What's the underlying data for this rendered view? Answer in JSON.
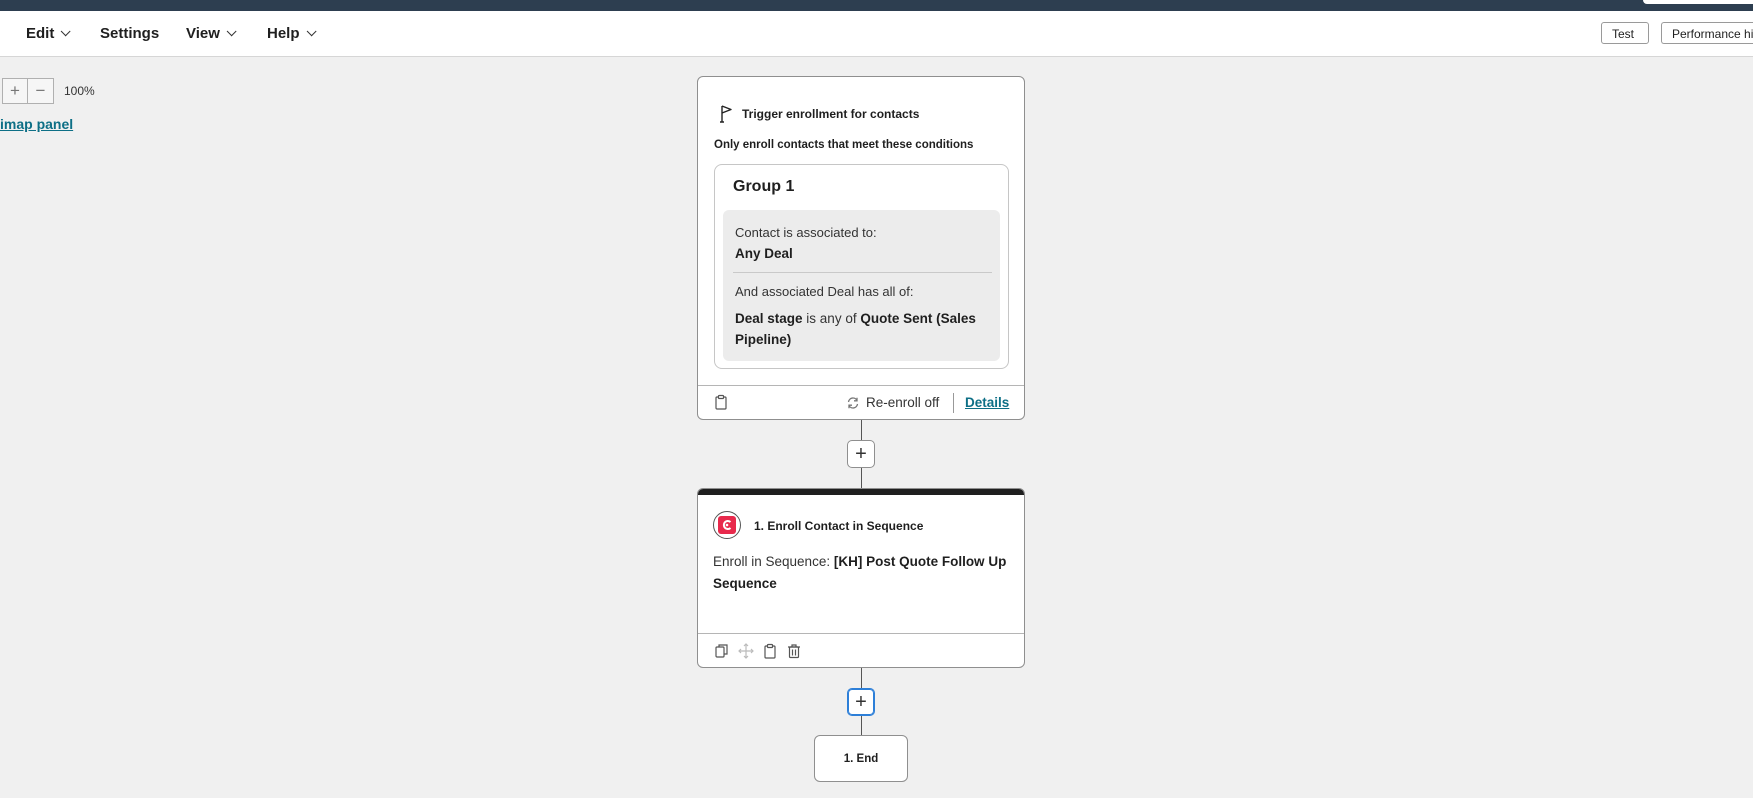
{
  "menu": {
    "edit": "Edit",
    "settings": "Settings",
    "view": "View",
    "help": "Help"
  },
  "top_buttons": {
    "test": "Test",
    "performance": "Performance hi"
  },
  "zoom": {
    "plus": "+",
    "minus": "−",
    "level": "100%"
  },
  "minimap_link": "imap panel",
  "trigger": {
    "title": "Trigger enrollment for contacts",
    "conditions_label": "Only enroll contacts that meet these conditions",
    "group_title": "Group 1",
    "line1": "Contact is associated to:",
    "line2": "Any Deal",
    "line3": "And associated Deal has all of:",
    "filter_prop": "Deal stage",
    "filter_op": " is any of ",
    "filter_value": "Quote Sent (Sales Pipeline)",
    "reenroll": "Re-enroll off",
    "details": "Details"
  },
  "add_button": "+",
  "action": {
    "title": "1. Enroll Contact in Sequence",
    "body_label": "Enroll in Sequence: ",
    "body_value": "[KH] Post Quote Follow Up Sequence"
  },
  "end": {
    "label": "1. End"
  },
  "colors": {
    "link": "#0d6f86",
    "sequence_icon": "#e8294c",
    "active_add": "#2d7fd8"
  }
}
